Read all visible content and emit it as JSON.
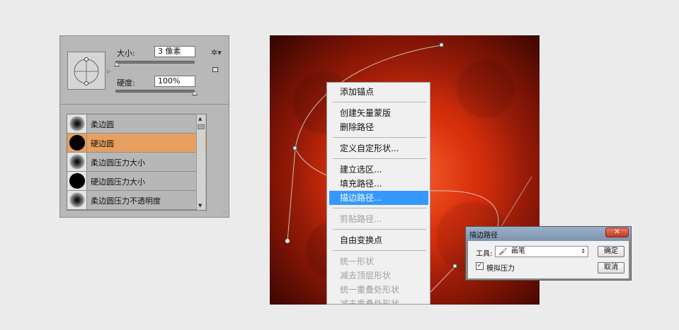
{
  "brush_panel": {
    "size_label": "大小:",
    "size_value": "3 像素",
    "hardness_label": "硬度:",
    "hardness_value": "100%",
    "size_slider_fraction": 0.02,
    "hardness_slider_fraction": 1.0,
    "presets": [
      {
        "name": "柔边圆",
        "kind": "soft",
        "selected": false
      },
      {
        "name": "硬边圆",
        "kind": "hard",
        "selected": true
      },
      {
        "name": "柔边圆压力大小",
        "kind": "soft",
        "selected": false
      },
      {
        "name": "硬边圆压力大小",
        "kind": "hard",
        "selected": false
      },
      {
        "name": "柔边圆压力不透明度",
        "kind": "soft",
        "selected": false
      }
    ]
  },
  "context_menu": {
    "items": [
      {
        "label": "添加锚点",
        "disabled": false,
        "highlighted": false
      },
      {
        "label": "创建矢量蒙版",
        "disabled": false,
        "highlighted": false
      },
      {
        "label": "删除路径",
        "disabled": false,
        "highlighted": false
      },
      {
        "label": "定义自定形状...",
        "disabled": false,
        "highlighted": false
      },
      {
        "label": "建立选区...",
        "disabled": false,
        "highlighted": false
      },
      {
        "label": "填充路径...",
        "disabled": false,
        "highlighted": false
      },
      {
        "label": "描边路径...",
        "disabled": false,
        "highlighted": true
      },
      {
        "label": "剪贴路径...",
        "disabled": true,
        "highlighted": false
      },
      {
        "label": "自由变换点",
        "disabled": false,
        "highlighted": false
      },
      {
        "label": "统一形状",
        "disabled": true,
        "highlighted": false
      },
      {
        "label": "减去顶层形状",
        "disabled": true,
        "highlighted": false
      },
      {
        "label": "统一重叠处形状",
        "disabled": true,
        "highlighted": false
      },
      {
        "label": "减去重叠处形状",
        "disabled": true,
        "highlighted": false
      }
    ]
  },
  "stroke_dialog": {
    "title": "描边路径",
    "close_glyph": "✕",
    "tool_label": "工具:",
    "tool_value": "画笔",
    "simulate_pressure_label": "模拟压力",
    "simulate_pressure_checked": true,
    "ok_label": "确定",
    "cancel_label": "取消"
  },
  "colors": {
    "highlight": "#3399ff",
    "selected_preset": "#e8a060",
    "canvas_center": "#e8401a"
  }
}
